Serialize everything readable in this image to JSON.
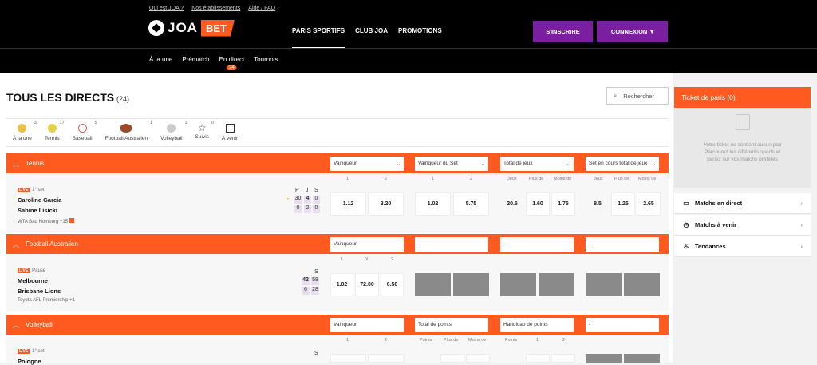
{
  "toplinks": [
    "Qui est JOA ?",
    "Nos établissements",
    "Aide / FAQ"
  ],
  "logo": {
    "joa": "JOA",
    "bet": "BET"
  },
  "nav": [
    "PARIS SPORTIFS",
    "CLUB JOA",
    "PROMOTIONS"
  ],
  "buttons": {
    "subscribe": "S'INSCRIRE",
    "login": "CONNEXION"
  },
  "subnav": [
    "À la une",
    "Prématch",
    "En direct",
    "Tournois"
  ],
  "subnav_badge": "24",
  "page": {
    "title": "TOUS LES DIRECTS",
    "count": "(24)",
    "search": "Rechercher"
  },
  "sports": [
    {
      "label": "À la une",
      "count": "3",
      "color": "#e8c34a"
    },
    {
      "label": "Tennis",
      "count": "17",
      "color": "#e6d24a"
    },
    {
      "label": "Baseball",
      "count": "5",
      "color": "#e25a5a"
    },
    {
      "label": "Football Australien",
      "count": "1",
      "color": "#9a4a2a"
    },
    {
      "label": "Volleyball",
      "count": "1",
      "color": "#bbbbbb"
    },
    {
      "label": "Suivis",
      "count": "0",
      "color": "#ffffff"
    },
    {
      "label": "À venir",
      "count": "",
      "color": "#555555"
    }
  ],
  "tennis": {
    "name": "Tennis",
    "markets": [
      "Vainqueur",
      "Vainqueur du Set",
      "Total de jeux",
      "Set en cours total de jeux"
    ],
    "cols1": [
      "1",
      "2"
    ],
    "cols2": [
      "1",
      "2"
    ],
    "cols3": [
      "Jeux",
      "Plus de",
      "Moins de"
    ],
    "cols4": [
      "Jeux",
      "Plus de",
      "Moins de"
    ],
    "live": "LIVE",
    "status": "1° set",
    "team1": "Caroline Garcia",
    "team2": "Sabine Lisicki",
    "meta": "WTA Bad Homburg",
    "more": "+15",
    "score_head": [
      "P",
      "J",
      "S"
    ],
    "s1": [
      "30",
      "4",
      "0"
    ],
    "s2": [
      "0",
      "2",
      "0"
    ],
    "o1": [
      "1.12",
      "3.20"
    ],
    "o2": [
      "1.02",
      "5.75"
    ],
    "o3": [
      "20.5",
      "1.60",
      "1.75"
    ],
    "o4": [
      "8.5",
      "1.25",
      "2.65"
    ]
  },
  "afl": {
    "name": "Football Australien",
    "markets": [
      "Vainqueur",
      "-",
      "-",
      "-"
    ],
    "cols": [
      "1",
      "X",
      "2"
    ],
    "live": "LIVE",
    "status": "Pause",
    "team1": "Melbourne",
    "team2": "Brisbane Lions",
    "meta": "Toyota AFL Premiership",
    "more": "+1",
    "score_head": "S",
    "s1": [
      "42",
      "58"
    ],
    "s2": [
      "6",
      "28"
    ],
    "odds": [
      "1.02",
      "72.00",
      "6.50"
    ]
  },
  "volley": {
    "name": "Volleyball",
    "markets": [
      "Vainqueur",
      "Total de points",
      "Handicap de points",
      "-"
    ],
    "cols1": [
      "1",
      "2"
    ],
    "cols2": [
      "Points",
      "Plus de",
      "Moins de"
    ],
    "cols3": [
      "Points",
      "1",
      "2"
    ],
    "live": "LIVE",
    "status": "1° set",
    "team1": "Pologne",
    "score_head": "S"
  },
  "ticket": {
    "title": "Ticket de paris (0)",
    "empty": "Votre ticket ne contient aucun pari",
    "hint1": "Parcourez les différents sports et",
    "hint2": "pariez sur vos matchs préférés"
  },
  "side": [
    "Matchs en direct",
    "Matchs à venir",
    "Tendances"
  ]
}
